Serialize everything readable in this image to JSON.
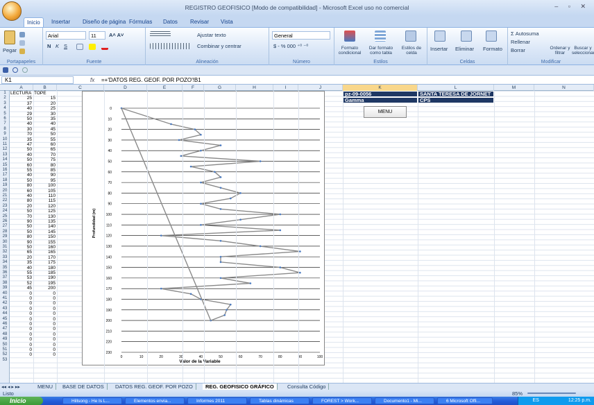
{
  "window": {
    "title": "REGISTRO GEOFISICO  [Modo de compatibilidad] - Microsoft Excel uso no comercial",
    "controls": "–  ▫  ✕"
  },
  "ribbon_tabs": [
    "Inicio",
    "Insertar",
    "Diseño de página",
    "Fórmulas",
    "Datos",
    "Revisar",
    "Vista"
  ],
  "ribbon": {
    "paste": "Pegar",
    "clipboard": "Portapapeles",
    "font_name": "Arial",
    "font_size": "11",
    "font_group": "Fuente",
    "wrap_text": "Ajustar texto",
    "merge": "Combinar y centrar",
    "alignment": "Alineación",
    "number_format": "General",
    "number_group": "Número",
    "cond_format": "Formato condicional",
    "table_format": "Dar formato como tabla",
    "cell_styles": "Estilos de celda",
    "styles_group": "Estilos",
    "insert": "Insertar",
    "delete": "Eliminar",
    "format": "Formato",
    "cells_group": "Celdas",
    "autosum": "Autosuma",
    "fill": "Rellenar",
    "clear": "Borrar",
    "sort": "Ordenar y filtrar",
    "find": "Buscar y seleccionar",
    "modify_group": "Modificar"
  },
  "formula_bar": {
    "cell": "K1",
    "fx": "fx",
    "formula": "=+'DATOS REG. GEOF. POR POZO'!B1"
  },
  "columns": [
    "A",
    "B",
    "C",
    "D",
    "E",
    "F",
    "G",
    "H",
    "I",
    "J",
    "K",
    "L",
    "M",
    "N"
  ],
  "data_headers": {
    "a": "LECTURA",
    "b": "TOPE"
  },
  "lectura": [
    "25",
    "37",
    "40",
    "29",
    "50",
    "40",
    "30",
    "70",
    "35",
    "47",
    "50",
    "40",
    "50",
    "60",
    "55",
    "40",
    "50",
    "80",
    "60",
    "40",
    "80",
    "20",
    "50",
    "70",
    "90",
    "50",
    "50",
    "80",
    "90",
    "50",
    "65",
    "20",
    "35",
    "40",
    "55",
    "53",
    "52",
    "45",
    "0",
    "0",
    "0",
    "0",
    "0",
    "0",
    "0",
    "0",
    "0",
    "0",
    "0",
    "0",
    "0"
  ],
  "tope": [
    "15",
    "20",
    "25",
    "30",
    "35",
    "40",
    "45",
    "50",
    "55",
    "60",
    "65",
    "70",
    "75",
    "80",
    "85",
    "90",
    "95",
    "100",
    "105",
    "110",
    "115",
    "120",
    "125",
    "130",
    "135",
    "140",
    "145",
    "150",
    "155",
    "160",
    "165",
    "170",
    "175",
    "180",
    "185",
    "190",
    "195",
    "200",
    "0",
    "0",
    "0",
    "0",
    "0",
    "0",
    "0",
    "0",
    "0",
    "0",
    "0",
    "0",
    "0"
  ],
  "info": {
    "well": "pz-09-0056",
    "name": "SANTA TERESA DE JORNET",
    "type": "Gamma",
    "unit": "CPS"
  },
  "menu_button": "MENU",
  "chart_data": {
    "type": "line",
    "xlabel": "Valor de la Variable",
    "ylabel": "Profundidad (m)",
    "xlim": [
      0,
      100
    ],
    "ylim": [
      0,
      230
    ],
    "xticks": [
      "0",
      "10",
      "20",
      "30",
      "40",
      "50",
      "60",
      "70",
      "80",
      "90",
      "100"
    ],
    "yticks": [
      "0",
      "10",
      "20",
      "30",
      "40",
      "50",
      "60",
      "70",
      "80",
      "90",
      "100",
      "110",
      "120",
      "130",
      "140",
      "150",
      "160",
      "170",
      "180",
      "190",
      "200",
      "210",
      "220",
      "230"
    ],
    "series": [
      {
        "x": [
          0,
          25,
          37,
          40,
          29,
          50,
          40,
          30,
          70,
          35,
          47,
          50,
          40,
          50,
          60,
          55,
          40,
          50,
          80,
          60,
          40,
          80,
          20,
          50,
          70,
          90,
          50,
          50,
          80,
          90,
          50,
          65,
          20,
          35,
          40,
          55,
          53,
          52,
          45
        ],
        "y": [
          0,
          15,
          20,
          25,
          30,
          35,
          40,
          45,
          50,
          55,
          60,
          65,
          70,
          75,
          80,
          85,
          90,
          95,
          100,
          105,
          110,
          115,
          120,
          125,
          130,
          135,
          140,
          145,
          150,
          155,
          160,
          165,
          170,
          175,
          180,
          185,
          190,
          195,
          200
        ]
      },
      {
        "x": [
          0,
          45
        ],
        "y": [
          0,
          200
        ]
      }
    ]
  },
  "sheet_tabs": [
    "MENU",
    "BASE DE DATOS",
    "DATOS REG. GEOF. POR POZO",
    "REG. GEOFISICO GRÁFICO",
    "Consulta Código"
  ],
  "status": {
    "ready": "Listo",
    "zoom": "85%"
  },
  "taskbar": {
    "start": "Inicio",
    "items": [
      "Hillsong - He Is L...",
      "Elementos envia...",
      "Informes 2011",
      "Tablas dinámicas",
      "FOREST > Work...",
      "Documento1 - Mi...",
      "6 Microsoft Offi..."
    ],
    "lang": "ES",
    "time": "12:25 p.m."
  }
}
